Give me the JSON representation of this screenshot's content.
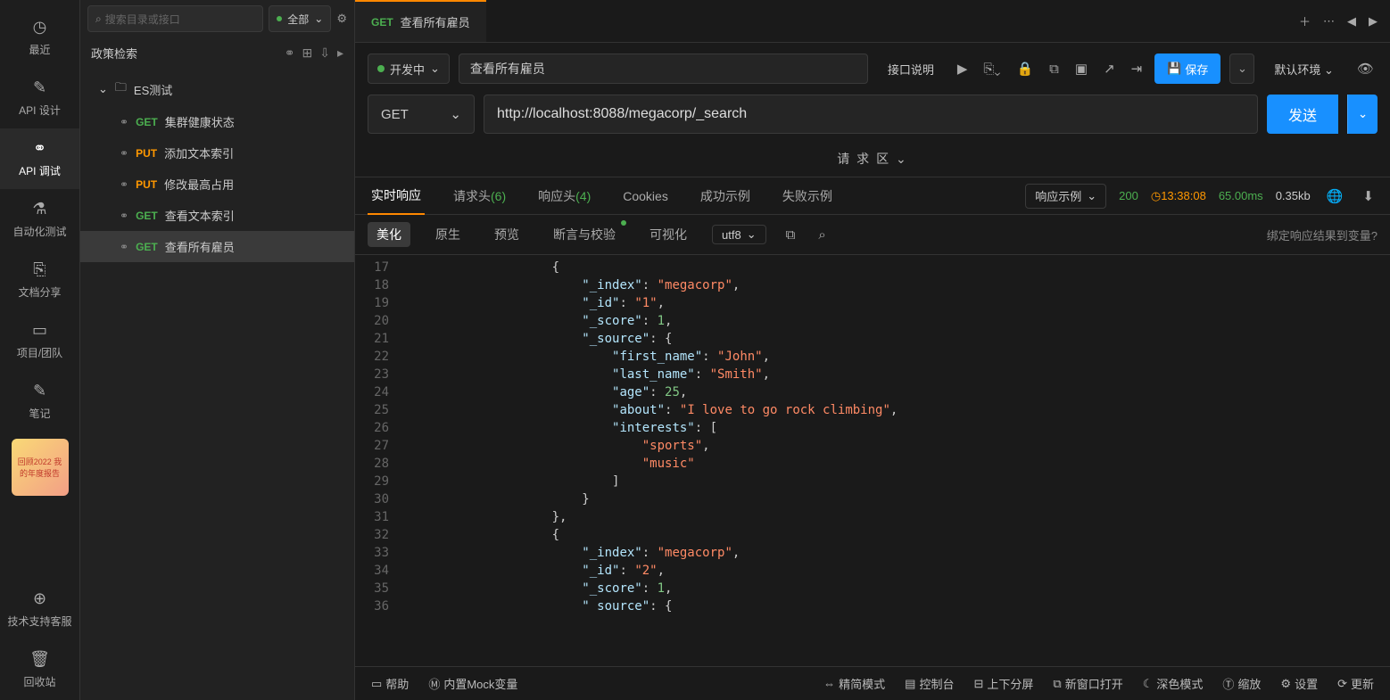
{
  "rail": {
    "items": [
      {
        "label": "最近"
      },
      {
        "label": "API 设计"
      },
      {
        "label": "API 调试"
      },
      {
        "label": "自动化测试"
      },
      {
        "label": "文档分享"
      },
      {
        "label": "项目/团队"
      },
      {
        "label": "笔记"
      }
    ],
    "banner": "回顾2022 我的年度报告",
    "support": "技术支持客服",
    "trash": "回收站"
  },
  "sidebar": {
    "search_placeholder": "搜索目录或接口",
    "filter_label": "全部",
    "crumb": "政策检索",
    "folder": "ES测试",
    "items": [
      {
        "method": "GET",
        "label": "集群健康状态"
      },
      {
        "method": "PUT",
        "label": "添加文本索引"
      },
      {
        "method": "PUT",
        "label": "修改最高占用"
      },
      {
        "method": "GET",
        "label": "查看文本索引"
      },
      {
        "method": "GET",
        "label": "查看所有雇员"
      }
    ]
  },
  "tabbar": {
    "tab_method": "GET",
    "tab_title": "查看所有雇员"
  },
  "toolbar": {
    "status": "开发中",
    "name": "查看所有雇员",
    "api_doc": "接口说明",
    "save": "保存",
    "env": "默认环境"
  },
  "urlbar": {
    "method": "GET",
    "url": "http://localhost:8088/megacorp/_search",
    "send": "发送"
  },
  "req_area": "请 求 区",
  "resp_tabs": {
    "realtime": "实时响应",
    "req_headers": "请求头",
    "req_headers_n": "(6)",
    "resp_headers": "响应头",
    "resp_headers_n": "(4)",
    "cookies": "Cookies",
    "success": "成功示例",
    "failure": "失败示例",
    "sample_label": "响应示例",
    "status": "200",
    "time": "13:38:08",
    "duration": "65.00ms",
    "size": "0.35kb"
  },
  "view_tabs": {
    "pretty": "美化",
    "raw": "原生",
    "preview": "预览",
    "assert": "断言与校验",
    "visual": "可视化",
    "encoding": "utf8",
    "bind_link": "绑定响应结果到变量?"
  },
  "response_lines": [
    {
      "n": 17,
      "indent": 5,
      "tokens": [
        {
          "t": "punc",
          "v": "{"
        }
      ]
    },
    {
      "n": 18,
      "indent": 6,
      "tokens": [
        {
          "t": "key",
          "v": "\"_index\""
        },
        {
          "t": "punc",
          "v": ": "
        },
        {
          "t": "str",
          "v": "\"megacorp\""
        },
        {
          "t": "punc",
          "v": ","
        }
      ]
    },
    {
      "n": 19,
      "indent": 6,
      "tokens": [
        {
          "t": "key",
          "v": "\"_id\""
        },
        {
          "t": "punc",
          "v": ": "
        },
        {
          "t": "str",
          "v": "\"1\""
        },
        {
          "t": "punc",
          "v": ","
        }
      ]
    },
    {
      "n": 20,
      "indent": 6,
      "tokens": [
        {
          "t": "key",
          "v": "\"_score\""
        },
        {
          "t": "punc",
          "v": ": "
        },
        {
          "t": "num",
          "v": "1"
        },
        {
          "t": "punc",
          "v": ","
        }
      ]
    },
    {
      "n": 21,
      "indent": 6,
      "tokens": [
        {
          "t": "key",
          "v": "\"_source\""
        },
        {
          "t": "punc",
          "v": ": {"
        }
      ]
    },
    {
      "n": 22,
      "indent": 7,
      "tokens": [
        {
          "t": "key",
          "v": "\"first_name\""
        },
        {
          "t": "punc",
          "v": ": "
        },
        {
          "t": "str",
          "v": "\"John\""
        },
        {
          "t": "punc",
          "v": ","
        }
      ]
    },
    {
      "n": 23,
      "indent": 7,
      "tokens": [
        {
          "t": "key",
          "v": "\"last_name\""
        },
        {
          "t": "punc",
          "v": ": "
        },
        {
          "t": "str",
          "v": "\"Smith\""
        },
        {
          "t": "punc",
          "v": ","
        }
      ]
    },
    {
      "n": 24,
      "indent": 7,
      "tokens": [
        {
          "t": "key",
          "v": "\"age\""
        },
        {
          "t": "punc",
          "v": ": "
        },
        {
          "t": "num",
          "v": "25"
        },
        {
          "t": "punc",
          "v": ","
        }
      ]
    },
    {
      "n": 25,
      "indent": 7,
      "tokens": [
        {
          "t": "key",
          "v": "\"about\""
        },
        {
          "t": "punc",
          "v": ": "
        },
        {
          "t": "str",
          "v": "\"I love to go rock climbing\""
        },
        {
          "t": "punc",
          "v": ","
        }
      ]
    },
    {
      "n": 26,
      "indent": 7,
      "tokens": [
        {
          "t": "key",
          "v": "\"interests\""
        },
        {
          "t": "punc",
          "v": ": ["
        }
      ]
    },
    {
      "n": 27,
      "indent": 8,
      "tokens": [
        {
          "t": "str",
          "v": "\"sports\""
        },
        {
          "t": "punc",
          "v": ","
        }
      ]
    },
    {
      "n": 28,
      "indent": 8,
      "tokens": [
        {
          "t": "str",
          "v": "\"music\""
        }
      ]
    },
    {
      "n": 29,
      "indent": 7,
      "tokens": [
        {
          "t": "punc",
          "v": "]"
        }
      ]
    },
    {
      "n": 30,
      "indent": 6,
      "tokens": [
        {
          "t": "punc",
          "v": "}"
        }
      ]
    },
    {
      "n": 31,
      "indent": 5,
      "tokens": [
        {
          "t": "punc",
          "v": "},"
        }
      ]
    },
    {
      "n": 32,
      "indent": 5,
      "tokens": [
        {
          "t": "punc",
          "v": "{"
        }
      ]
    },
    {
      "n": 33,
      "indent": 6,
      "tokens": [
        {
          "t": "key",
          "v": "\"_index\""
        },
        {
          "t": "punc",
          "v": ": "
        },
        {
          "t": "str",
          "v": "\"megacorp\""
        },
        {
          "t": "punc",
          "v": ","
        }
      ]
    },
    {
      "n": 34,
      "indent": 6,
      "tokens": [
        {
          "t": "key",
          "v": "\"_id\""
        },
        {
          "t": "punc",
          "v": ": "
        },
        {
          "t": "str",
          "v": "\"2\""
        },
        {
          "t": "punc",
          "v": ","
        }
      ]
    },
    {
      "n": 35,
      "indent": 6,
      "tokens": [
        {
          "t": "key",
          "v": "\"_score\""
        },
        {
          "t": "punc",
          "v": ": "
        },
        {
          "t": "num",
          "v": "1"
        },
        {
          "t": "punc",
          "v": ","
        }
      ]
    },
    {
      "n": 36,
      "indent": 6,
      "tokens": [
        {
          "t": "key",
          "v": "\" source\""
        },
        {
          "t": "punc",
          "v": ": {"
        }
      ]
    }
  ],
  "statusbar": {
    "help": "帮助",
    "mock": "内置Mock变量",
    "compact": "精简模式",
    "console": "控制台",
    "split": "上下分屏",
    "newwin": "新窗口打开",
    "dark": "深色模式",
    "zoom": "缩放",
    "settings": "设置",
    "refresh": "更新"
  }
}
